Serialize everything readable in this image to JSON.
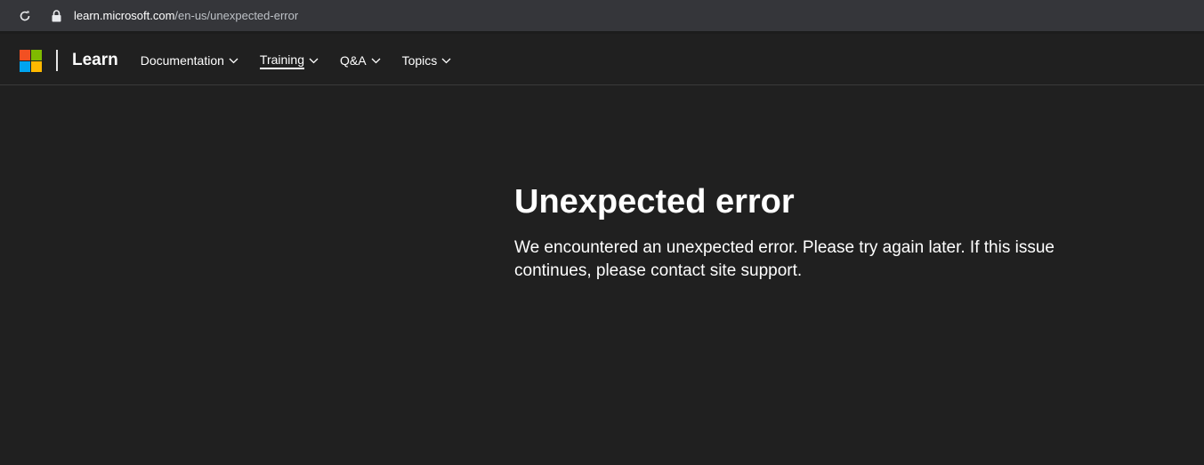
{
  "browser": {
    "url_host": "learn.microsoft.com",
    "url_path": "/en-us/unexpected-error",
    "reload_icon": "reload-icon",
    "lock_icon": "lock-icon"
  },
  "header": {
    "logo_icon": "microsoft-logo-icon",
    "logo_colors": [
      "#f25022",
      "#7fba00",
      "#00a4ef",
      "#ffb900"
    ],
    "brand": "Learn",
    "nav": [
      {
        "label": "Documentation",
        "active": false
      },
      {
        "label": "Training",
        "active": true
      },
      {
        "label": "Q&A",
        "active": false
      },
      {
        "label": "Topics",
        "active": false
      }
    ]
  },
  "main": {
    "title": "Unexpected error",
    "message": "We encountered an unexpected error. Please try again later. If this issue continues, please contact site support."
  },
  "colors": {
    "background": "#202020",
    "browser_bar": "#35363a",
    "text": "#ffffff"
  }
}
